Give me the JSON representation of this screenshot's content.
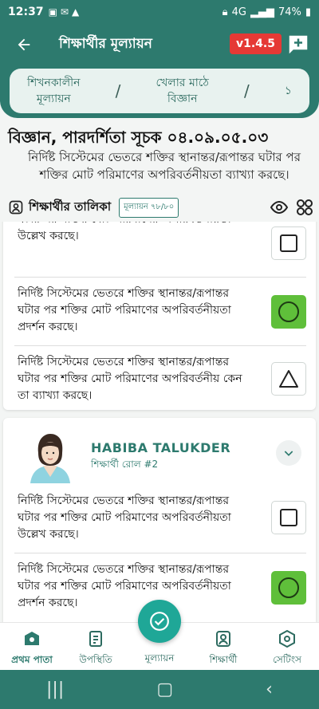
{
  "status_bar": {
    "time": "12:37",
    "network": "4G",
    "battery": "74%"
  },
  "appbar": {
    "title": "শিক্ষার্থীর মূল্যায়ন",
    "version": "v1.4.5"
  },
  "breadcrumb": {
    "items": [
      {
        "line1": "শিখনকালীন",
        "line2": "মূল্যায়ন"
      },
      {
        "line1": "খেলার মাঠে",
        "line2": "বিজ্ঞান"
      },
      {
        "line1": "১",
        "line2": ""
      }
    ],
    "separator": "/"
  },
  "indicator": {
    "title": "বিজ্ঞান, পারদর্শিতা সূচক ০৪.০৯.০৫.০৩",
    "description": "নির্দিষ্ট সিস্টেমের ভেতরে শক্তির স্থানান্তর/রূপান্তর ঘটার পর শক্তির মোট পরিমাণের অপরিবর্তনীয়তা ব্যাখ্যা করছে।"
  },
  "student_list": {
    "label": "শিক্ষার্থীর তালিকা",
    "eval_count": "মূল্যায়ন ৭৮/৮০"
  },
  "cards": [
    {
      "criteria": [
        {
          "text": "নির্দিষ্ট সিস্টেমের ভেতরে শক্তির স্থানান্তর/রূপান্তর ঘটার পর শক্তির মোট পরিমাণের অপরিবর্তনীয়তা উল্লেখ করছে।",
          "mark": "square",
          "selected": false
        },
        {
          "text": "নির্দিষ্ট সিস্টেমের ভেতরে শক্তির স্থানান্তর/রূপান্তর ঘটার পর শক্তির মোট পরিমাণের অপরিবর্তনীয়তা প্রদর্শন করছে।",
          "mark": "circle",
          "selected": true
        },
        {
          "text": "নির্দিষ্ট সিস্টেমের ভেতরে শক্তির স্থানান্তর/রূপান্তর ঘটার পর শক্তির মোট পরিমাণের অপরিবর্তনীয় কেন তা ব্যাখ্যা করছে।",
          "mark": "triangle",
          "selected": false
        }
      ]
    },
    {
      "student_name": "HABIBA TALUKDER",
      "roll": "শিক্ষার্থী রোল #2",
      "criteria": [
        {
          "text": "নির্দিষ্ট সিস্টেমের ভেতরে শক্তির স্থানান্তর/রূপান্তর ঘটার পর শক্তির মোট পরিমাণের অপরিবর্তনীয়তা উল্লেখ করছে।",
          "mark": "square",
          "selected": false
        },
        {
          "text": "নির্দিষ্ট সিস্টেমের ভেতরে শক্তির স্থানান্তর/রূপান্তর ঘটার পর শক্তির মোট পরিমাণের অপরিবর্তনীয়তা প্রদর্শন করছে।",
          "mark": "circle",
          "selected": true
        }
      ]
    }
  ],
  "bottom_nav": {
    "items": [
      {
        "label": "প্রথম পাতা",
        "icon": "home-icon"
      },
      {
        "label": "উপস্থিতি",
        "icon": "attendance-icon"
      },
      {
        "label": "মূল্যায়ন",
        "icon": "evaluation-icon"
      },
      {
        "label": "শিক্ষার্থী",
        "icon": "student-icon"
      },
      {
        "label": "সেটিংস",
        "icon": "settings-icon"
      }
    ]
  },
  "colors": {
    "primary": "#2d7a6e",
    "accent": "#1fa797",
    "selected": "#5fbf3a",
    "version_badge": "#e53935"
  }
}
